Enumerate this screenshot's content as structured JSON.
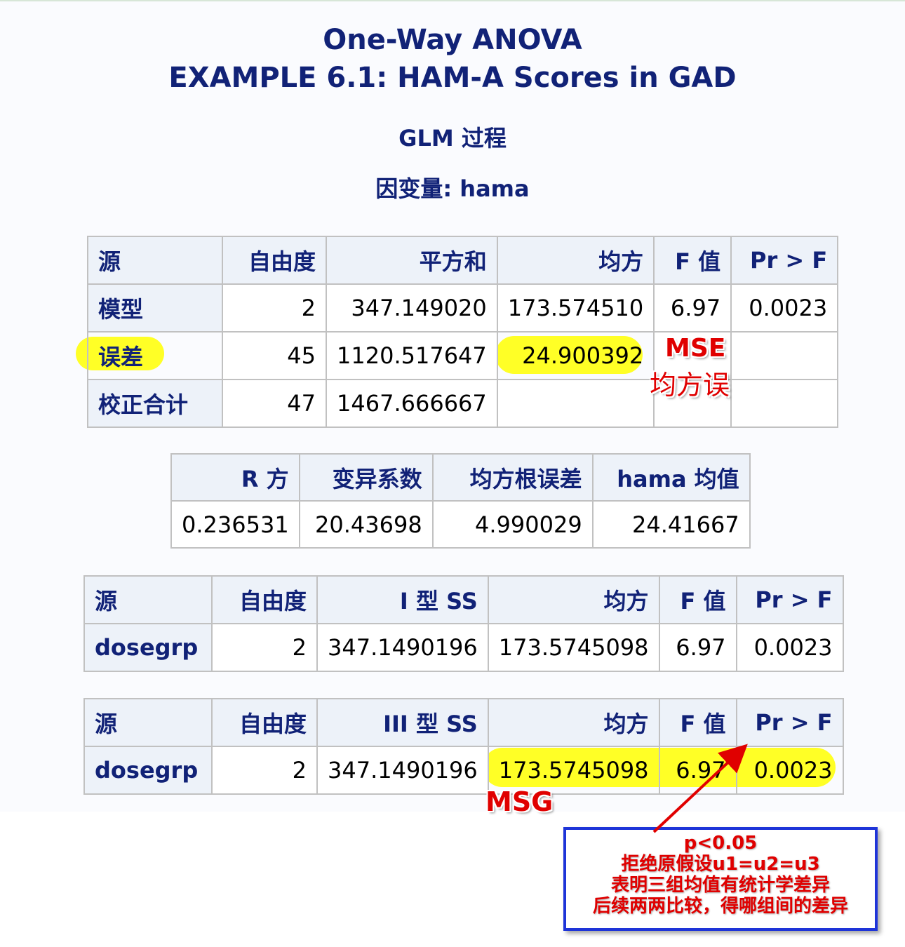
{
  "titles": {
    "main": "One-Way ANOVA",
    "example": "EXAMPLE 6.1: HAM-A Scores in GAD",
    "procedure": "GLM 过程",
    "dependent": "因变量: hama"
  },
  "anova_table": {
    "headers": [
      "源",
      "自由度",
      "平方和",
      "均方",
      "F 值",
      "Pr > F"
    ],
    "rows": [
      {
        "source": "模型",
        "df": "2",
        "ss": "347.149020",
        "ms": "173.574510",
        "f": "6.97",
        "p": "0.0023"
      },
      {
        "source": "误差",
        "df": "45",
        "ss": "1120.517647",
        "ms": "24.900392",
        "f": "",
        "p": ""
      },
      {
        "source": "校正合计",
        "df": "47",
        "ss": "1467.666667",
        "ms": "",
        "f": "",
        "p": ""
      }
    ]
  },
  "fit_table": {
    "headers": [
      "R 方",
      "变异系数",
      "均方根误差",
      "hama 均值"
    ],
    "values": [
      "0.236531",
      "20.43698",
      "4.990029",
      "24.41667"
    ]
  },
  "type1_table": {
    "headers": [
      "源",
      "自由度",
      "I 型 SS",
      "均方",
      "F 值",
      "Pr > F"
    ],
    "row": {
      "source": "dosegrp",
      "df": "2",
      "ss": "347.1490196",
      "ms": "173.5745098",
      "f": "6.97",
      "p": "0.0023"
    }
  },
  "type3_table": {
    "headers": [
      "源",
      "自由度",
      "III 型 SS",
      "均方",
      "F 值",
      "Pr > F"
    ],
    "row": {
      "source": "dosegrp",
      "df": "2",
      "ss": "347.1490196",
      "ms": "173.5745098",
      "f": "6.97",
      "p": "0.0023"
    }
  },
  "annotations": {
    "mse_label": "MSE",
    "mse_desc": "均方误",
    "msg_label": "MSG",
    "conclusion": [
      "p<0.05",
      "拒绝原假设u1=u2=u3",
      "表明三组均值有统计学差异",
      "后续两两比较，得哪组间的差异"
    ],
    "highlight_color": "#ffff00",
    "annotation_color": "#e00000",
    "box_border_color": "#1e34d8"
  }
}
